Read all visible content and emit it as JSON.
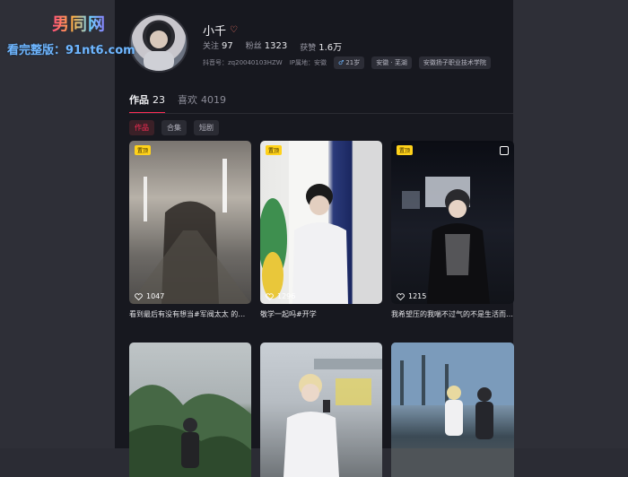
{
  "watermark": {
    "logo": "男同网",
    "text": "看完整版：91nt6.com"
  },
  "profile": {
    "name": "小千",
    "name_emoji": "♡",
    "stats": [
      {
        "label": "关注",
        "value": "97"
      },
      {
        "label": "粉丝",
        "value": "1323"
      },
      {
        "label": "获赞",
        "value": "1.6万"
      }
    ],
    "account_label": "抖音号：zq20040103HZW",
    "ip_label": "IP属地：安徽",
    "tags": [
      {
        "icon": "male-icon",
        "text": "21岁"
      },
      {
        "icon": "",
        "text": "安徽 · 芜湖"
      },
      {
        "icon": "",
        "text": "安徽扬子职业技术学院"
      }
    ]
  },
  "tabs": [
    {
      "label": "作品",
      "count": "23",
      "active": true
    },
    {
      "label": "喜欢",
      "count": "4019",
      "active": false
    }
  ],
  "filters": [
    {
      "label": "作品",
      "active": true
    },
    {
      "label": "合集",
      "active": false
    },
    {
      "label": "短剧",
      "active": false
    }
  ],
  "videos": [
    {
      "pinned": true,
      "pin_label": "置顶",
      "likes": "1047",
      "caption": "看到最后有没有想当#军阀太太 的冲动"
    },
    {
      "pinned": true,
      "pin_label": "置顶",
      "likes": "1296",
      "caption": "敬学一起吗#开学"
    },
    {
      "pinned": true,
      "pin_label": "置顶",
      "likes": "1215",
      "caption": "我希望压的我喘不过气的不是生活而…"
    },
    {
      "pinned": false,
      "pin_label": "",
      "likes": "",
      "caption": ""
    },
    {
      "pinned": false,
      "pin_label": "",
      "likes": "",
      "caption": ""
    },
    {
      "pinned": false,
      "pin_label": "",
      "likes": "",
      "caption": ""
    }
  ],
  "colors": {
    "accent": "#fe2c55",
    "background": "#17181f",
    "pin": "#ffd21a"
  }
}
